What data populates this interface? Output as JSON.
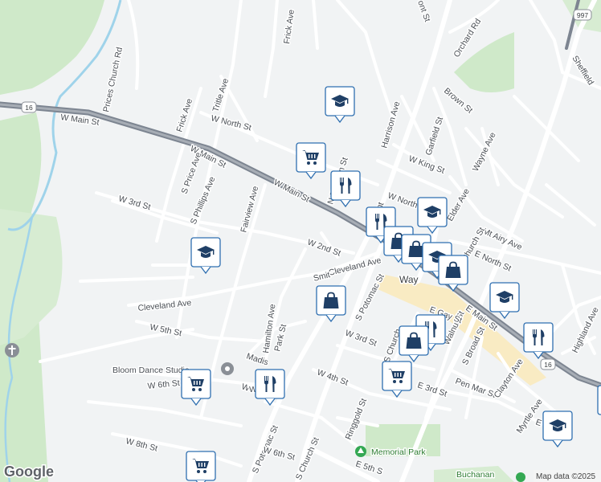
{
  "streets": {
    "w_main_st": "W Main St",
    "w_main_st_2": "W Main St",
    "w_main_st_3": "W Main St",
    "frick_ave_top": "Frick Ave",
    "frick_ave": "Frick Ave",
    "tritle_ave": "Tritle Ave",
    "w_north_st": "W North St",
    "prices_church_rd": "Prices Church Rd",
    "s_price_ave": "S Price Ave",
    "s_phillips_ave": "S Phillips Ave",
    "w_3rd_st": "W 3rd St",
    "fairview_ave": "Fairview Ave",
    "w_2nd_st": "W 2nd St",
    "cleveland_ave": "Cleveland Ave",
    "cleveland_ave_2": "Cleveland Ave",
    "w_5th_st": "W 5th St",
    "hamilton_ave": "Hamilton Ave",
    "park_st": "Park St",
    "madison": "Madis",
    "w_6th_st": "W 6th St",
    "w_7th": "W",
    "w_8th_st": "W 8th St",
    "s_potomac_st": "S Potomac St",
    "s_potomac_st_2": "S Potomac St",
    "w_4th_st": "W 4th St",
    "w_3rd_st_2": "W 3rd St",
    "s_church": "S Church",
    "ringgold_st": "Ringgold St",
    "w_6th_st_2": "W 6th St",
    "s_church_2": "S Church St",
    "e_5th_st": "E 5th S",
    "e_3rd_st": "E 3rd St",
    "pen_mar_st": "Pen Mar St",
    "walnut_st": "Walnut St",
    "s_broad_st": "S Broad St",
    "e_main_st": "E Main St",
    "clayton_ave": "Clayton Ave",
    "myrtle_ave": "Myrtle Ave",
    "highland_ave": "Highland Ave",
    "e_north_st": "E North St",
    "mt_airy_ave": "Mt Airy Ave",
    "church_st": "Church St",
    "elder_ave": "Elder Ave",
    "w_north": "W North",
    "w_king_st": "W King St",
    "wayne_ave": "Wayne Ave",
    "garfield_st": "Garfield St",
    "brown_st": "Brown St",
    "harrison_ave": "Harrison Ave",
    "n_franklin_st": "N Franklin St",
    "n_mont_st": "N Mont",
    "orchard_rd": "Orchard Rd",
    "sheffield": "Sheffield",
    "mont_st_top": "ont St",
    "e_gay_st": "E Gay St",
    "e_short": "E",
    "w_partial": "W"
  },
  "places": {
    "waynesboro": "Way",
    "bloom_dance_studio": "Bloom Dance Studio",
    "memorial_park": "Memorial Park",
    "buchanan": "Buchanan",
    "smith": "Smit"
  },
  "shields": {
    "route_16_west": "16",
    "route_16_east": "16",
    "route_997": "997"
  },
  "attribution": {
    "logo": "Google",
    "map_data": "Map data ©2025"
  },
  "markers": [
    {
      "icon": "school-icon",
      "label": "school"
    },
    {
      "icon": "cart-icon",
      "label": "grocery"
    },
    {
      "icon": "restaurant-icon",
      "label": "restaurant"
    },
    {
      "icon": "school-icon",
      "label": "school"
    },
    {
      "icon": "restaurant-icon",
      "label": "restaurant"
    },
    {
      "icon": "school-icon",
      "label": "school"
    },
    {
      "icon": "shopping-bag-icon",
      "label": "shop"
    },
    {
      "icon": "shopping-bag-icon",
      "label": "shop"
    },
    {
      "icon": "school-icon",
      "label": "school"
    },
    {
      "icon": "shopping-bag-icon",
      "label": "shop"
    },
    {
      "icon": "restaurant-icon",
      "label": "restaurant"
    },
    {
      "icon": "cart-icon",
      "label": "grocery"
    },
    {
      "icon": "restaurant-icon",
      "label": "restaurant"
    },
    {
      "icon": "restaurant-icon",
      "label": "restaurant"
    },
    {
      "icon": "cart-icon",
      "label": "grocery"
    },
    {
      "icon": "cart-icon",
      "label": "grocery"
    },
    {
      "icon": "school-icon",
      "label": "school"
    }
  ],
  "colors": {
    "land": "#f1f3f4",
    "park": "#cfe9c9",
    "marker_border": "#2f6fb0",
    "marker_icon": "#1f3f66",
    "highway": "#7d8591",
    "downtown": "#fbe9b7"
  }
}
